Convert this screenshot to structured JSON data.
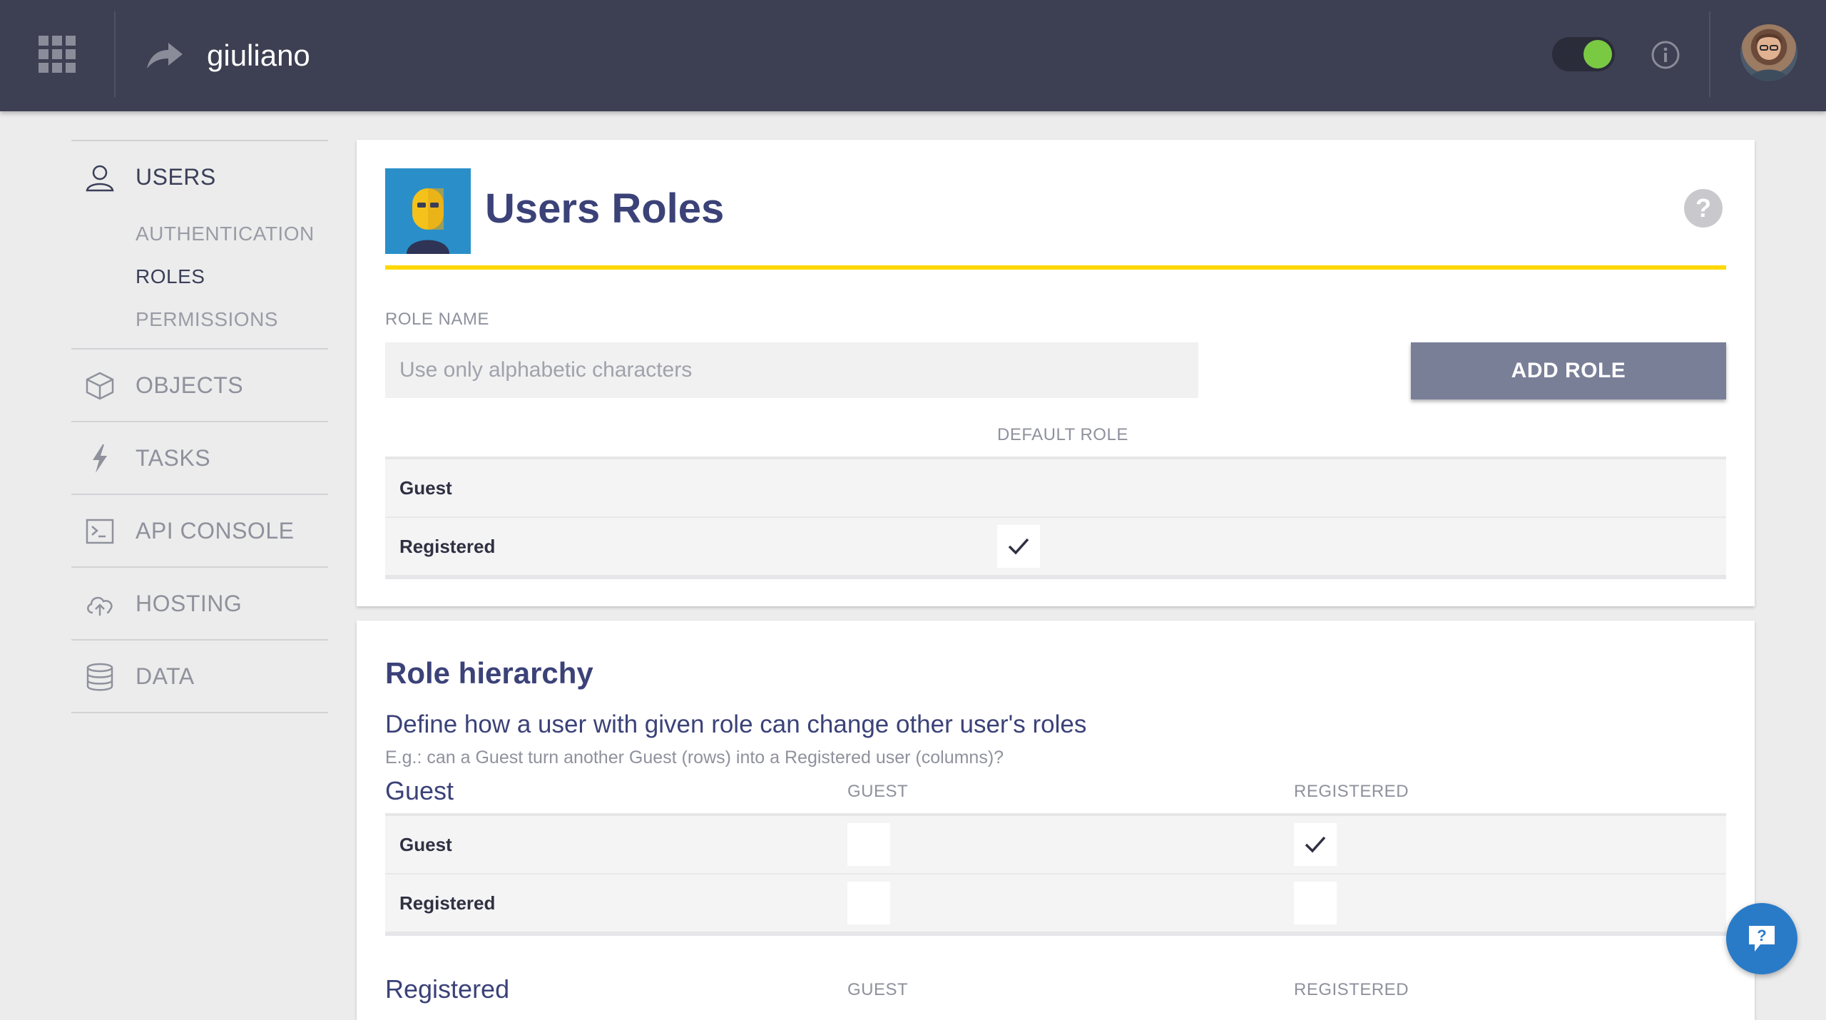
{
  "topbar": {
    "instance_name": "giuliano",
    "toggle_state": "on",
    "colors": {
      "bar": "#3d3f52",
      "toggle_on": "#7ac943"
    }
  },
  "sidebar": {
    "items": [
      {
        "label": "USERS",
        "icon": "user-icon",
        "active": true,
        "subitems": [
          {
            "label": "AUTHENTICATION",
            "active": false
          },
          {
            "label": "ROLES",
            "active": true
          },
          {
            "label": "PERMISSIONS",
            "active": false
          }
        ]
      },
      {
        "label": "OBJECTS",
        "icon": "cube-icon"
      },
      {
        "label": "TASKS",
        "icon": "lightning-icon"
      },
      {
        "label": "API CONSOLE",
        "icon": "terminal-icon"
      },
      {
        "label": "HOSTING",
        "icon": "cloud-upload-icon"
      },
      {
        "label": "DATA",
        "icon": "database-icon"
      }
    ]
  },
  "roles_card": {
    "title": "Users Roles",
    "field_label": "ROLE NAME",
    "input_placeholder": "Use only alphabetic characters",
    "input_value": "",
    "add_button": "ADD ROLE",
    "column_header": "DEFAULT ROLE",
    "rows": [
      {
        "name": "Guest",
        "default": false
      },
      {
        "name": "Registered",
        "default": true
      }
    ],
    "accent_color": "#ffd800"
  },
  "hierarchy_card": {
    "title": "Role hierarchy",
    "description": "Define how a user with given role can change other user's roles",
    "hint": "E.g.: can a Guest turn another Guest (rows) into a Registered user (columns)?",
    "groups": [
      {
        "name": "Guest",
        "columns": [
          "GUEST",
          "REGISTERED"
        ],
        "rows": [
          {
            "name": "Guest",
            "values": [
              false,
              true
            ]
          },
          {
            "name": "Registered",
            "values": [
              false,
              false
            ]
          }
        ]
      },
      {
        "name": "Registered",
        "columns": [
          "GUEST",
          "REGISTERED"
        ]
      }
    ]
  },
  "help_chat": {
    "icon": "chat-help-icon",
    "glyph": "?"
  }
}
